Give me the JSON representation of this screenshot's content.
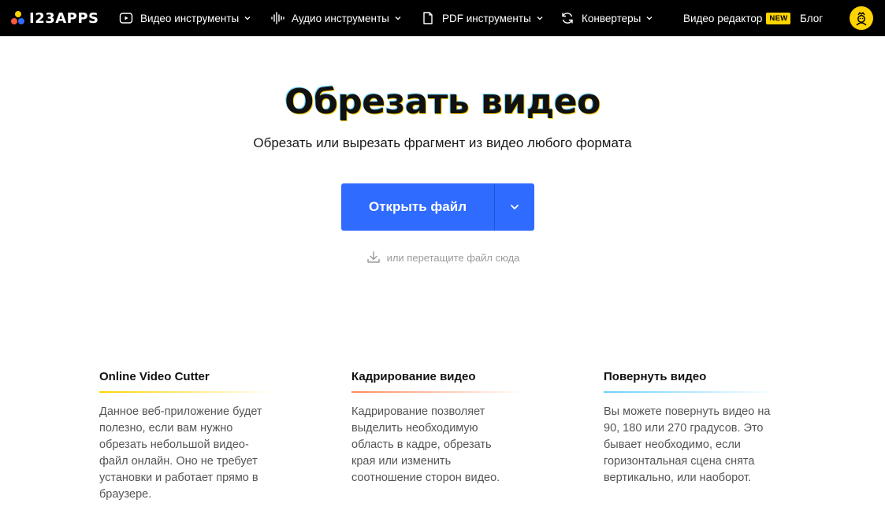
{
  "nav": {
    "logo_text": "I23APPS",
    "items": [
      {
        "label": "Видео инструменты",
        "icon": "play-icon"
      },
      {
        "label": "Аудио инструменты",
        "icon": "audio-wave-icon"
      },
      {
        "label": "PDF инструменты",
        "icon": "document-icon"
      },
      {
        "label": "Конвертеры",
        "icon": "convert-icon"
      }
    ],
    "video_editor_label": "Видео редактор",
    "new_badge": "NEW",
    "blog_label": "Блог",
    "avatar_icon": "user-avatar-icon"
  },
  "hero": {
    "title": "Обрезать видео",
    "subtitle": "Обрезать или вырезать фрагмент из видео любого формата",
    "open_button": "Открыть файл",
    "drop_hint": "или перетащите файл сюда"
  },
  "features": [
    {
      "title": "Online Video Cutter",
      "text": "Данное веб-приложение будет полезно, если вам нужно обрезать небольшой видео-файл онлайн. Оно не требует установки и работает прямо в браузере.",
      "accent": "#ffd400"
    },
    {
      "title": "Кадрирование видео",
      "text": "Кадрирование позволяет выделить необходимую область в кадре, обрезать края или изменить соотношение сторон видео.",
      "accent": "#ff8a5c"
    },
    {
      "title": "Повернуть видео",
      "text": "Вы можете повернуть видео на 90, 180 или 270 градусов. Это бывает необходимо, если горизонтальная сцена снята вертикально, или наоборот.",
      "accent": "#6ad1ff"
    }
  ],
  "colors": {
    "nav_bg": "#000000",
    "primary": "#2f6bff",
    "badge": "#ffd400"
  }
}
